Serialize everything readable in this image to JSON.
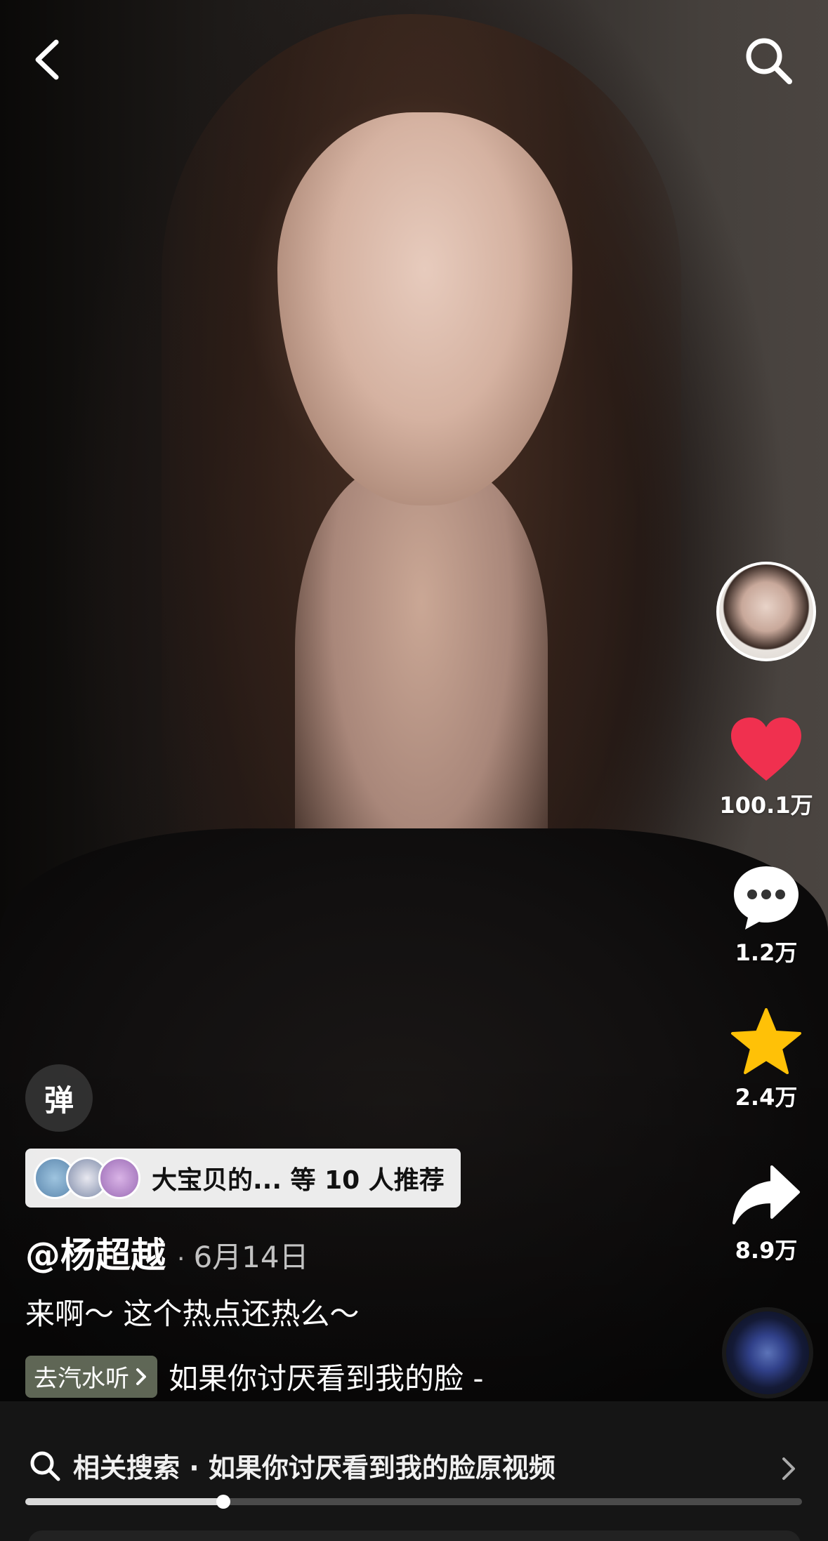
{
  "top_bar": {
    "back_icon": "chevron-left-icon",
    "search_icon": "search-icon"
  },
  "rail": {
    "avatar_icon": "creator-avatar",
    "like": {
      "icon": "heart-icon",
      "count": "100.1万",
      "color": "#f0304f"
    },
    "comment": {
      "icon": "comment-bubble-icon",
      "count": "1.2万"
    },
    "favorite": {
      "icon": "star-icon",
      "count": "2.4万",
      "color": "#ffc107"
    },
    "share": {
      "icon": "share-arrow-icon",
      "count": "8.9万"
    },
    "music_disc_icon": "music-disc"
  },
  "danmu": {
    "label": "弹"
  },
  "recommend": {
    "text": "大宝贝的... 等 10 人推荐"
  },
  "post": {
    "author": "@杨超越",
    "date": "6月14日",
    "caption": "来啊～ 这个热点还热么～"
  },
  "music": {
    "badge": "去汽水听",
    "song": "如果你讨厌看到我的脸 -"
  },
  "related_search": {
    "text": "相关搜索 · 如果你讨厌看到我的脸原视频"
  },
  "progress": {
    "fraction": 0.255
  }
}
